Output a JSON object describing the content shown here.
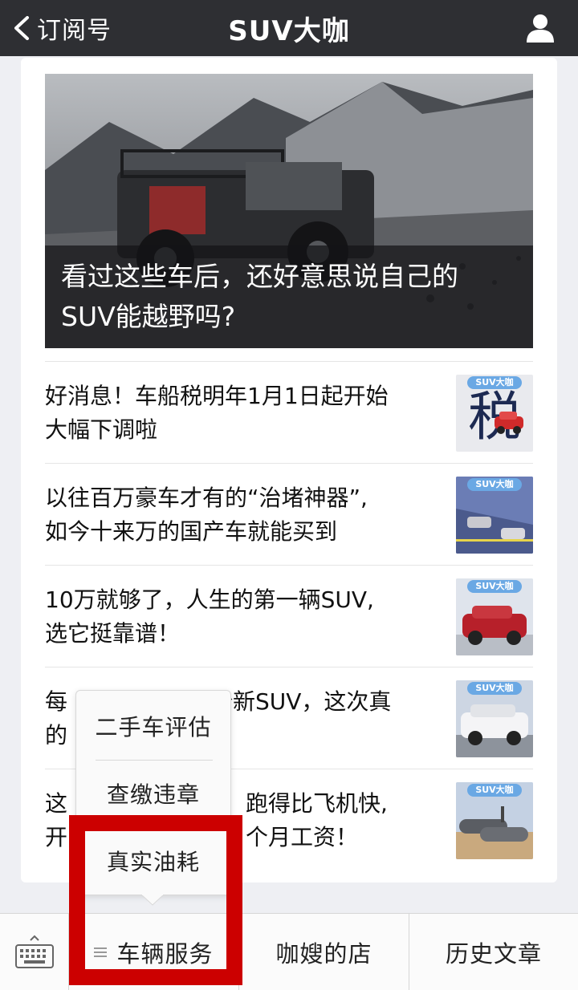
{
  "header": {
    "back_label": "订阅号",
    "title": "SUV大咖"
  },
  "hero": {
    "caption_line1": "看过这些车后，还好意思说自己的",
    "caption_line2": "SUV能越野吗?"
  },
  "articles": [
    {
      "line1": "好消息！车船税明年1月1日起开始",
      "line2": "大幅下调啦",
      "thumb_tag": "SUV大咖",
      "thumb_char": "税"
    },
    {
      "line1": "以往百万豪车才有的“治堵神器”,",
      "line2": "如今十来万的国产车就能买到",
      "thumb_tag": "SUV大咖"
    },
    {
      "line1": "10万就够了，人生的第一辆SUV,",
      "line2": "选它挺靠谱！",
      "thumb_tag": "SUV大咖"
    },
    {
      "line1_left": "每",
      "line1_right": "全新SUV，这次真",
      "line2_left": "的",
      "line2_right": "了",
      "thumb_tag": "SUV大咖"
    },
    {
      "line1_left": "这",
      "line1_right": "跑得比飞机快,",
      "line2_left": "开",
      "line2_right": "个月工资！",
      "thumb_tag": "SUV大咖"
    }
  ],
  "popup_menu": {
    "items": [
      "二手车评估",
      "查缴违章",
      "真实油耗"
    ]
  },
  "bottom_menu": {
    "items": [
      "车辆服务",
      "咖嫂的店",
      "历史文章"
    ]
  },
  "colors": {
    "header_bg": "#2e2f33",
    "highlight": "#cc0000",
    "thumb_tag": "#6aa8e4"
  }
}
